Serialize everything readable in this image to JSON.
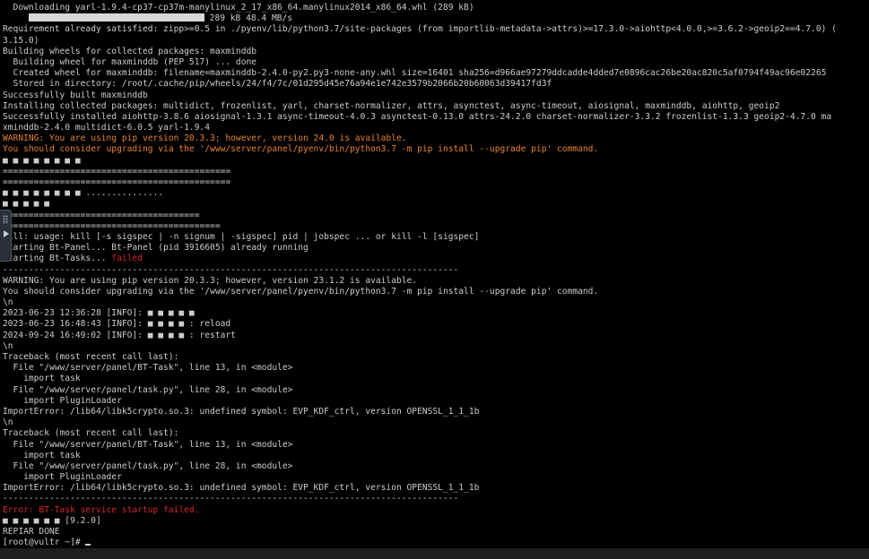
{
  "theme": {
    "background": "#000000",
    "foreground": "#cccccc",
    "warning": "#e8822f",
    "error": "#d62626"
  },
  "lines": [
    {
      "text": "  Downloading yarl-1.9.4-cp37-cp37m-manylinux_2_17_x86_64.manylinux2014_x86_64.whl (289 kB)"
    },
    {
      "type": "progress",
      "prefix": "     ",
      "suffix": " 289 kB 48.4 MB/s",
      "fraction": 1.0
    },
    {
      "text": "Requirement already satisfied: zipp>=0.5 in ./pyenv/lib/python3.7/site-packages (from importlib-metadata->attrs)>=17.3.0->aiohttp<4.0.0,>=3.6.2->geoip2==4.7.0) ("
    },
    {
      "text": "3.15.0)"
    },
    {
      "text": "Building wheels for collected packages: maxminddb"
    },
    {
      "text": "  Building wheel for maxminddb (PEP 517) ... done"
    },
    {
      "text": "  Created wheel for maxminddb: filename=maxminddb-2.4.0-py2.py3-none-any.whl size=16401 sha256=d966ae97279ddcadde4dded7e0896cac26be20ac820c5af0794f49ac96e02265"
    },
    {
      "text": "  Stored in directory: /root/.cache/pip/wheels/24/f4/7c/01d295d45e76a94e1e742e3579b2066b20b60063d39417fd3f"
    },
    {
      "text": "Successfully built maxminddb"
    },
    {
      "text": "Installing collected packages: multidict, frozenlist, yarl, charset-normalizer, attrs, asynctest, async-timeout, aiosignal, maxminddb, aiohttp, geoip2"
    },
    {
      "text": "Successfully installed aiohttp-3.8.6 aiosignal-1.3.1 async-timeout-4.0.3 asynctest-0.13.0 attrs-24.2.0 charset-normalizer-3.3.2 frozenlist-1.3.3 geoip2-4.7.0 ma"
    },
    {
      "text": "xminddb-2.4.0 multidict-6.0.5 yarl-1.9.4"
    },
    {
      "text": "WARNING: You are using pip version 20.3.3; however, version 24.0 is available.",
      "color": "orange"
    },
    {
      "text": "You should consider upgrading via the '/www/server/panel/pyenv/bin/python3.7 -m pip install --upgrade pip' command.",
      "color": "orange"
    },
    {
      "text": "■ ■ ■ ■ ■ ■ ■ ■"
    },
    {
      "text": "============================================"
    },
    {
      "text": "============================================"
    },
    {
      "text": "■ ■ ■ ■ ■ ■ ■ ■ ..............."
    },
    {
      "text": "■ ■ ■ ■ ■"
    },
    {
      "text": "======================================"
    },
    {
      "text": "=========================================="
    },
    {
      "text": "kill: usage: kill [-s sigspec | -n signum | -sigspec] pid | jobspec ... or kill -l [sigspec]"
    },
    {
      "text": "Starting Bt-Panel... Bt-Panel (pid 3916605) already running"
    },
    {
      "text": "Starting Bt-Tasks... ",
      "red_suffix": "failed"
    },
    {
      "text": "----------------------------------------------------------------------------------------"
    },
    {
      "text": "WARNING: You are using pip version 20.3.3; however, version 23.1.2 is available."
    },
    {
      "text": "You should consider upgrading via the '/www/server/panel/pyenv/bin/python3.7 -m pip install --upgrade pip' command."
    },
    {
      "text": "\\n"
    },
    {
      "text": "2023-06-23 12:36:28 [INFO]: ■ ■ ■ ■ ■"
    },
    {
      "text": "2023-06-23 16:48:43 [INFO]: ■ ■ ■ ■ : reload"
    },
    {
      "text": "2024-09-24 16:49:02 [INFO]: ■ ■ ■ ■ : restart"
    },
    {
      "text": "\\n"
    },
    {
      "text": "Traceback (most recent call last):"
    },
    {
      "text": "  File \"/www/server/panel/BT-Task\", line 13, in <module>"
    },
    {
      "text": "    import task"
    },
    {
      "text": "  File \"/www/server/panel/task.py\", line 28, in <module>"
    },
    {
      "text": "    import PluginLoader"
    },
    {
      "text": "ImportError: /lib64/libk5crypto.so.3: undefined symbol: EVP_KDF_ctrl, version OPENSSL_1_1_1b"
    },
    {
      "text": "\\n"
    },
    {
      "text": "Traceback (most recent call last):"
    },
    {
      "text": "  File \"/www/server/panel/BT-Task\", line 13, in <module>"
    },
    {
      "text": "    import task"
    },
    {
      "text": "  File \"/www/server/panel/task.py\", line 28, in <module>"
    },
    {
      "text": "    import PluginLoader"
    },
    {
      "text": "ImportError: /lib64/libk5crypto.so.3: undefined symbol: EVP_KDF_ctrl, version OPENSSL_1_1_1b"
    },
    {
      "text": "----------------------------------------------------------------------------------------"
    },
    {
      "text": "Error: BT-Task service startup failed.",
      "color": "red"
    },
    {
      "text": "■ ■ ■ ■ ■ ■ [9.2.0]"
    },
    {
      "text": "REPIAR DONE"
    },
    {
      "type": "prompt",
      "text": "[root@vultr ~]# "
    }
  ]
}
